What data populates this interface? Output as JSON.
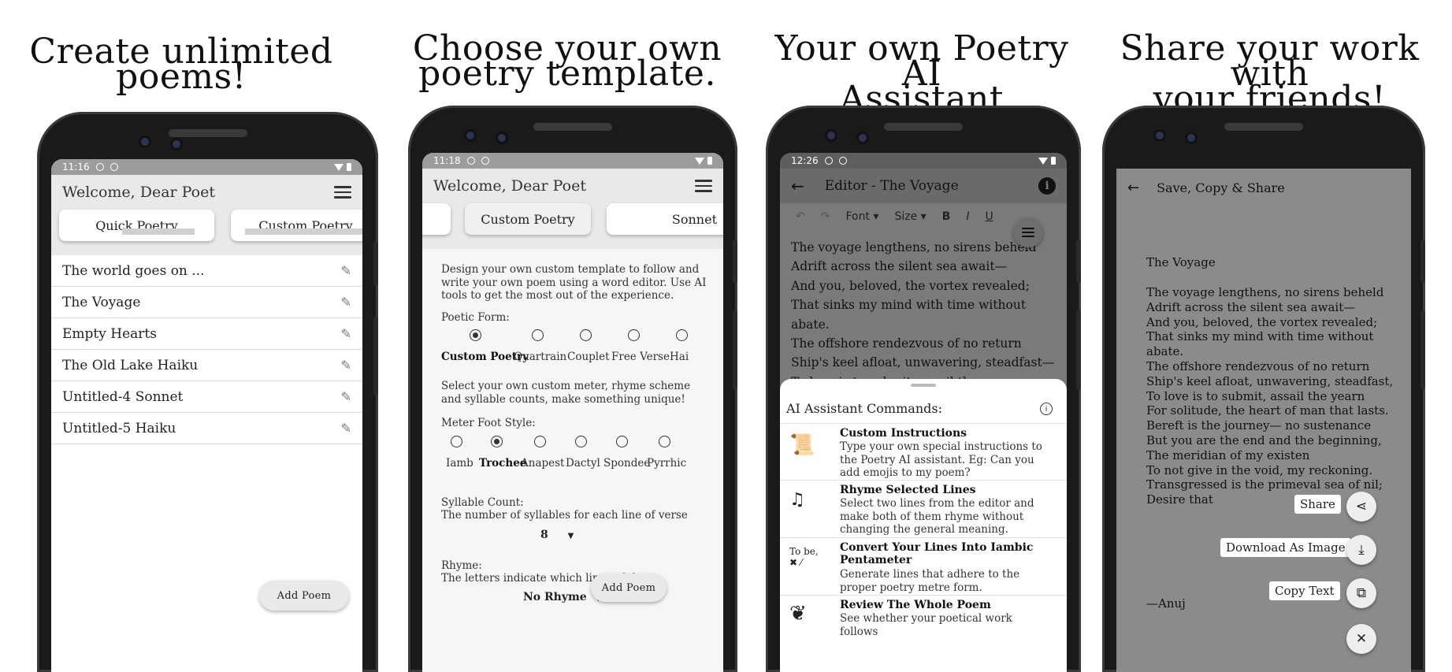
{
  "panel1": {
    "headline": [
      "Create unlimited",
      "poems!"
    ],
    "status_time": "11:16",
    "welcome": "Welcome, Dear Poet",
    "tabs": [
      "Quick Poetry",
      "Custom Poetry"
    ],
    "poems": [
      "The world goes on ...",
      "The Voyage",
      "Empty Hearts",
      "The Old Lake Haiku",
      "Untitled-4  Sonnet",
      "Untitled-5  Haiku"
    ],
    "add_poem": "Add Poem"
  },
  "panel2": {
    "headline": [
      "Choose your own",
      "poetry template."
    ],
    "status_time": "11:18",
    "welcome": "Welcome, Dear Poet",
    "tabs": [
      "Custom Poetry",
      "Sonnet"
    ],
    "intro": "Design your own custom template to follow and write your own poem using a word editor. Use AI tools to get the most out of the experience.",
    "poetic_form_label": "Poetic Form:",
    "poetic_forms": [
      "Custom Poetry",
      "Quartrain",
      "Couplet",
      "Free Verse",
      "Hai"
    ],
    "meter_intro": "Select your own custom meter, rhyme scheme and syllable counts, make something unique!",
    "meter_label": "Meter Foot Style:",
    "meter_feet": [
      "Iamb",
      "Trochee",
      "Anapest",
      "Dactyl",
      "Spondee",
      "Pyrrhic"
    ],
    "syllable_label": "Syllable Count:",
    "syllable_desc": "The number of syllables for each line of verse",
    "syllable_value": "8",
    "rhyme_label": "Rhyme:",
    "rhyme_desc": "The letters indicate which lines of th",
    "rhyme_value": "No Rhyme",
    "add_poem": "Add Poem"
  },
  "panel3": {
    "headline": [
      "Your own Poetry AI",
      "Assistant"
    ],
    "status_time": "12:26",
    "editor_title": "Editor - The Voyage",
    "toolbar": {
      "font": "Font",
      "size": "Size",
      "bold": "B",
      "italic": "I",
      "underline": "U"
    },
    "lines": [
      "The voyage lengthens, no sirens beheld",
      "Adrift across the silent sea await—",
      "And you, beloved, the vortex revealed;",
      "That sinks my mind with time without abate.",
      "The offshore rendezvous of no return",
      "Ship's keel afloat, unwavering, steadfast—",
      "To love is to submit, assail the yearn"
    ],
    "sheet_title": "AI Assistant Commands:",
    "commands": [
      {
        "title": "Custom Instructions",
        "desc": "Type your own special instructions to the Poetry AI assistant. Eg: Can you add emojis to my poem?",
        "icon": "scroll-quill-icon"
      },
      {
        "title": "Rhyme Selected Lines",
        "desc": "Select two lines from the editor and make both of them rhyme without changing the general meaning.",
        "icon": "rhyme-icon"
      },
      {
        "title": "Convert Your Lines Into Iambic Pentameter",
        "desc": "Generate lines that adhere to the proper poetry metre form.",
        "icon": "to-be-icon"
      },
      {
        "title": "Review The Whole Poem",
        "desc": "See whether your poetical work follows",
        "icon": "laurel-icon"
      }
    ],
    "to_be_icon_text": "To be,"
  },
  "panel4": {
    "headline": [
      "Share your work with",
      "your friends!"
    ],
    "title": "Save, Copy & Share",
    "poem_title": "The Voyage",
    "lines": [
      "The voyage lengthens, no sirens beheld",
      "Adrift across the silent sea await—",
      "And you, beloved, the vortex revealed;",
      "That sinks my mind with time without",
      "abate.",
      "The offshore rendezvous of no return",
      "Ship's keel afloat, unwavering, steadfast,",
      "To love is to submit, assail the yearn",
      "For solitude, the heart of man that lasts.",
      "Bereft is the journey— no sustenance",
      "But you are the end and the beginning,",
      "The meridian of my existen",
      "To not give in the void, my reckoning.",
      "Transgressed is the primeval sea of nil;",
      "Desire that"
    ],
    "author": "—Anuj",
    "share": "Share",
    "download": "Download As Image",
    "copy": "Copy Text",
    "close_glyph": "✕"
  }
}
